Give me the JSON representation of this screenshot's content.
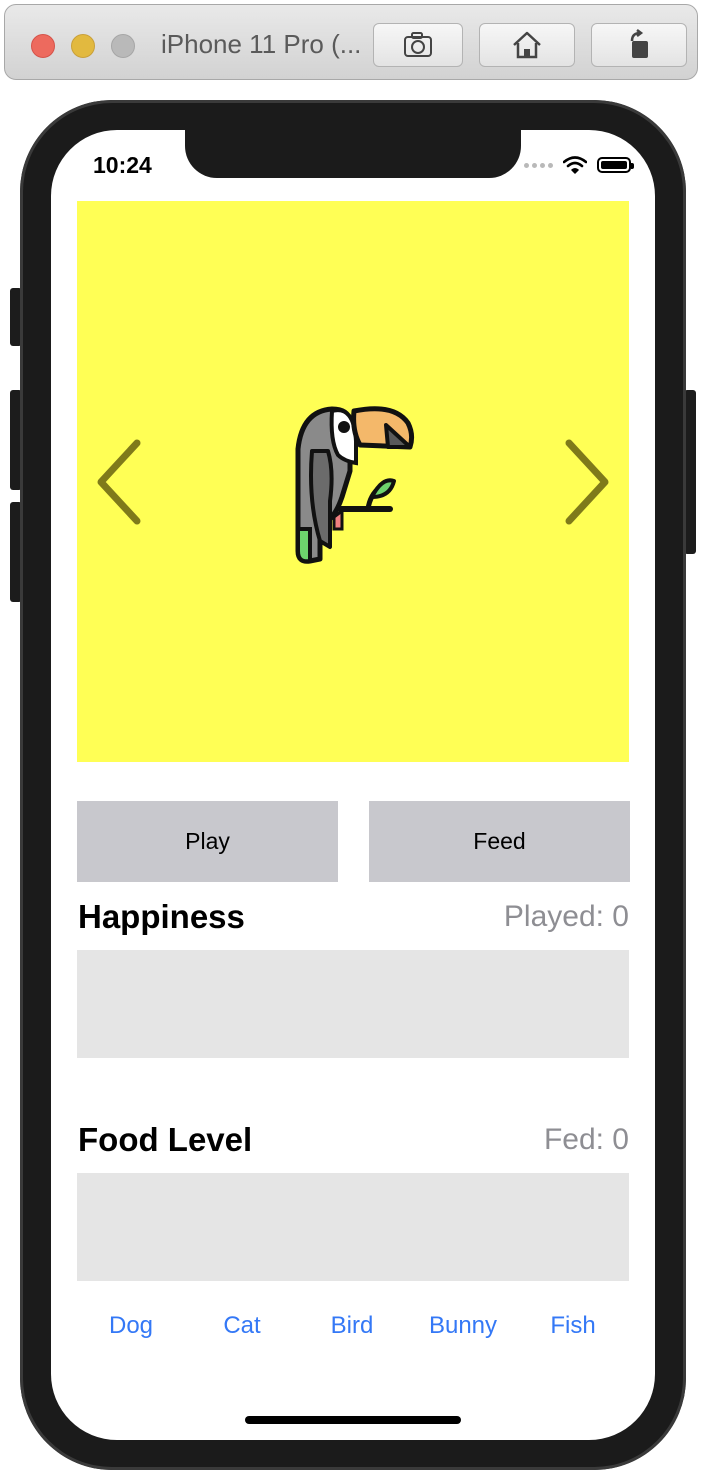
{
  "window": {
    "title": "iPhone 11 Pro (...",
    "toolbar_icons": [
      "screenshot-icon",
      "home-icon",
      "rotate-icon"
    ]
  },
  "status_bar": {
    "time": "10:24",
    "icons": [
      "signal-icon",
      "wifi-icon",
      "battery-icon"
    ]
  },
  "pet": {
    "background_color": "#ffff55",
    "image": "toucan-icon",
    "prev_icon": "chevron-left-icon",
    "next_icon": "chevron-right-icon"
  },
  "actions": {
    "play_label": "Play",
    "feed_label": "Feed"
  },
  "happiness": {
    "title": "Happiness",
    "count_text": "Played: 0",
    "level": 0
  },
  "food": {
    "title": "Food Level",
    "count_text": "Fed: 0",
    "level": 0
  },
  "tabs": [
    {
      "label": "Dog"
    },
    {
      "label": "Cat"
    },
    {
      "label": "Bird"
    },
    {
      "label": "Bunny"
    },
    {
      "label": "Fish"
    }
  ],
  "colors": {
    "accent": "#3478f6",
    "button_bg": "#c8c8cd",
    "meter_bg": "#e5e5e5",
    "secondary_text": "#8e8e93"
  }
}
